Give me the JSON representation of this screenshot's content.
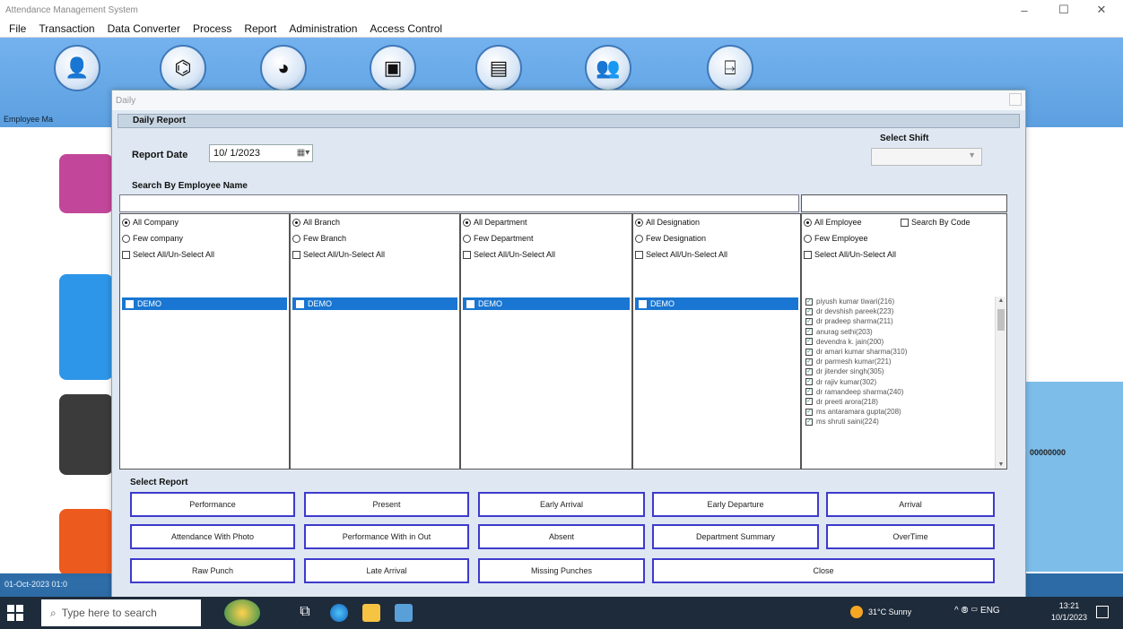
{
  "window": {
    "title": "Attendance Management System",
    "minimize": "–",
    "maximize": "☐",
    "close": "✕"
  },
  "menu": [
    "File",
    "Transaction",
    "Data Converter",
    "Process",
    "Report",
    "Administration",
    "Access Control"
  ],
  "toolbar": {
    "first_label": "Employee Ma",
    "icons": [
      "employee-icon",
      "shift-icon",
      "chart-icon",
      "id-card-icon",
      "report-doc-icon",
      "users-icon",
      "exit-door-icon"
    ]
  },
  "background": {
    "status_left": "01-Oct-2023 01:0",
    "right_panel_text": "00000000"
  },
  "dialog": {
    "title": "Daily",
    "group_title": "Daily Report",
    "report_date_label": "Report Date",
    "report_date_value": "10/ 1/2023",
    "shift_label": "Select Shift",
    "search_label": "Search By Employee Name",
    "columns": [
      {
        "all": "All Company",
        "few": "Few company",
        "select_all": "Select All/Un-Select All",
        "item": "DEMO"
      },
      {
        "all": "All Branch",
        "few": "Few Branch",
        "select_all": "Select All/Un-Select All",
        "item": "DEMO"
      },
      {
        "all": "All Department",
        "few": "Few Department",
        "select_all": "Select All/Un-Select All",
        "item": "DEMO"
      },
      {
        "all": "All Designation",
        "few": "Few Designation",
        "select_all": "Select All/Un-Select All",
        "item": "DEMO"
      }
    ],
    "employee_column": {
      "all": "All Employee",
      "few": "Few Employee",
      "search_by_code": "Search By Code",
      "select_all": "Select All/Un-Select All",
      "employees": [
        "piyush kumar tiwari(216)",
        "dr devshish pareek(223)",
        "dr pradeep sharma(211)",
        "anurag sethi(203)",
        "devendra k. jain(200)",
        "dr amari kumar sharma(310)",
        "dr parmesh kumar(221)",
        "dr jitender singh(305)",
        "dr rajiv kumar(302)",
        "dr ramandeep sharma(240)",
        "dr preeti arora(218)",
        "ms antaramara gupta(208)",
        "ms shruti saini(224)"
      ]
    },
    "select_report_label": "Select Report",
    "report_buttons": [
      "Performance",
      "Present",
      "Early Arrival",
      "Early Departure",
      "Arrival",
      "Attendance With Photo",
      "Performance With in Out",
      "Absent",
      "Department Summary",
      "OverTime",
      "Raw Punch",
      "Late Arrival",
      "Missing Punches",
      "Close"
    ]
  },
  "taskbar": {
    "search_placeholder": "Type here to search",
    "weather": "31°C Sunny",
    "tray": "^ ⦾ ▭ ENG",
    "time": "13:21",
    "date": "10/1/2023"
  }
}
